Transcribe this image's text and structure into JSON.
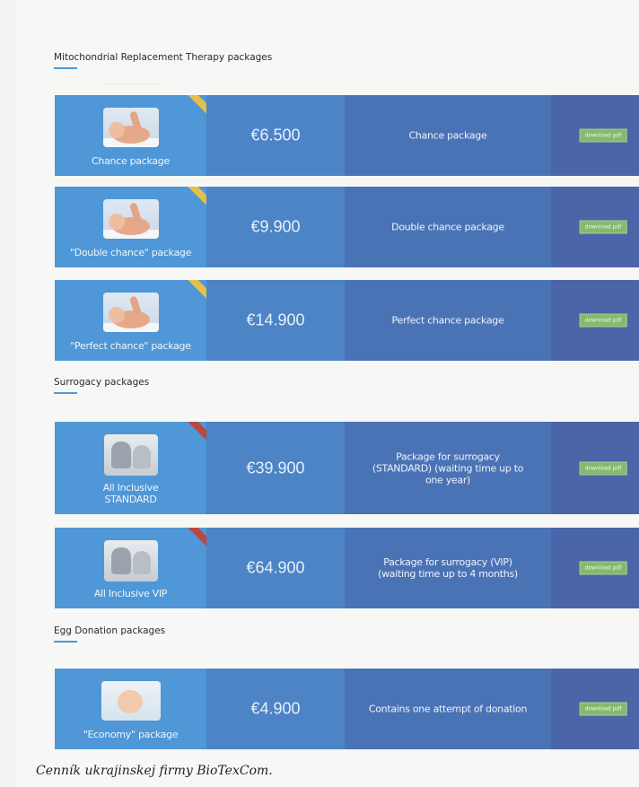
{
  "caption": "Cenník ukrajinskej firmy BioTexCom.",
  "sections": [
    {
      "title": "Mitochondrial Replacement Therapy packages",
      "rows": [
        {
          "thumb_label": "Chance package",
          "price": "€6.500",
          "description": "Chance package",
          "download": "download pdf",
          "photo": "baby",
          "ribbon_color": "#e3c04a"
        },
        {
          "thumb_label": "\"Double chance\" package",
          "price": "€9.900",
          "description": "Double chance package",
          "download": "download pdf",
          "photo": "baby",
          "ribbon_color": "#e3c04a"
        },
        {
          "thumb_label": "\"Perfect chance\" package",
          "price": "€14.900",
          "description": "Perfect chance package",
          "download": "download pdf",
          "photo": "baby",
          "ribbon_color": "#e3c04a"
        }
      ]
    },
    {
      "title": "Surrogacy packages",
      "rows": [
        {
          "thumb_label": "All Inclusive STANDARD",
          "price": "€39.900",
          "description": "Package for surrogacy (STANDARD) (waiting time up to one year)",
          "download": "download pdf",
          "photo": "family",
          "ribbon_color": "#c0463d"
        },
        {
          "thumb_label": "All Inclusive VIP",
          "price": "€64.900",
          "description": "Package for surrogacy (VIP) (waiting time up to 4 months)",
          "download": "download pdf",
          "photo": "family",
          "ribbon_color": "#c0463d"
        }
      ]
    },
    {
      "title": "Egg Donation packages",
      "rows": [
        {
          "thumb_label": "\"Economy\" package",
          "price": "€4.900",
          "description": "Contains one attempt of donation",
          "download": "download pdf",
          "photo": "baby-face",
          "ribbon_color": ""
        }
      ]
    }
  ]
}
